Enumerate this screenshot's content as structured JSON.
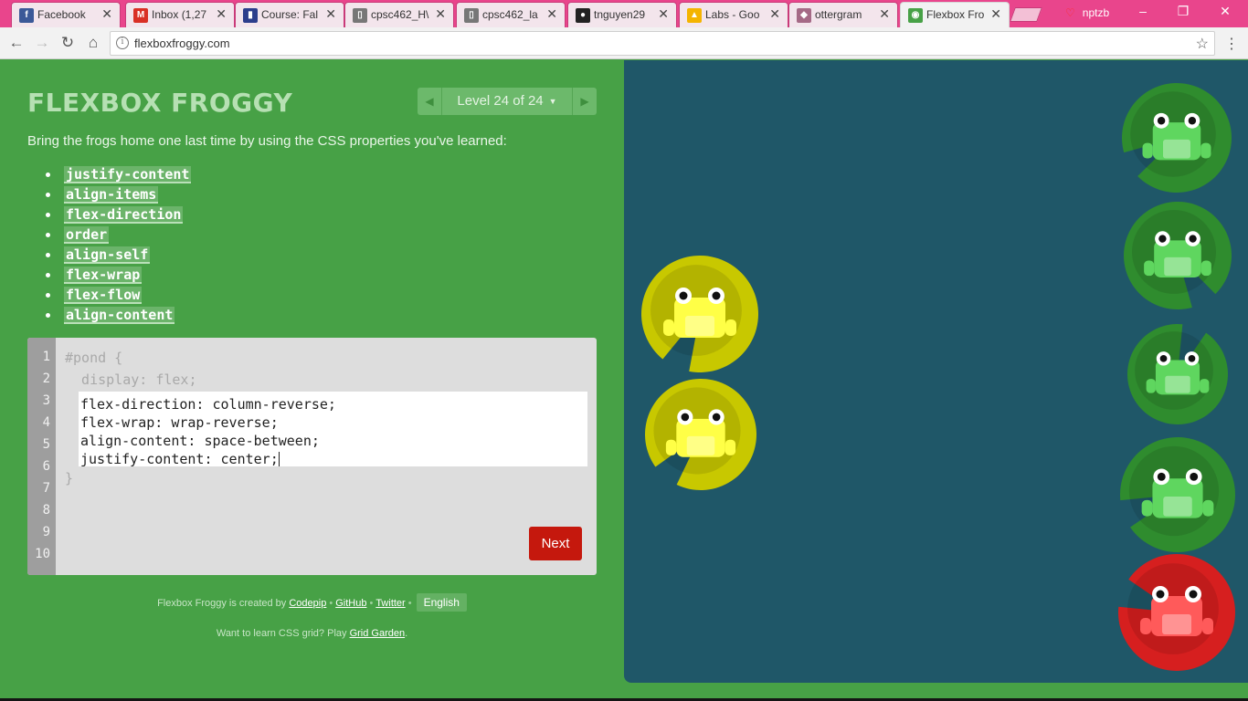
{
  "browser": {
    "tabs": [
      {
        "title": "Facebook",
        "icon": "facebook-icon",
        "color": "#3b5998",
        "glyph": "f"
      },
      {
        "title": "Inbox (1,27",
        "icon": "gmail-icon",
        "color": "#d93025",
        "glyph": "M"
      },
      {
        "title": "Course: Fal",
        "icon": "moodle-icon",
        "color": "#2c3e8c",
        "glyph": "▮"
      },
      {
        "title": "cpsc462_H\\",
        "icon": "document-icon",
        "color": "#777777",
        "glyph": "▯"
      },
      {
        "title": "cpsc462_la",
        "icon": "document-icon",
        "color": "#777777",
        "glyph": "▯"
      },
      {
        "title": "tnguyen29",
        "icon": "github-icon",
        "color": "#222222",
        "glyph": "●"
      },
      {
        "title": "Labs - Goo",
        "icon": "google-drive-icon",
        "color": "#f4b400",
        "glyph": "▲"
      },
      {
        "title": "ottergram",
        "icon": "ottergram-icon",
        "color": "#a56a86",
        "glyph": "◆"
      },
      {
        "title": "Flexbox Fro",
        "icon": "frog-icon",
        "color": "#47a146",
        "glyph": "◉"
      }
    ],
    "active_tab": 8,
    "profile_name": "nptzb",
    "url": "flexboxfroggy.com"
  },
  "game": {
    "title": "FLEXBOX FROGGY",
    "level_label": "Level 24 of 24",
    "instructions": "Bring the frogs home one last time by using the CSS properties you've learned:",
    "properties": [
      "justify-content",
      "align-items",
      "flex-direction",
      "order",
      "align-self",
      "flex-wrap",
      "flex-flow",
      "align-content"
    ],
    "line_numbers": [
      "1",
      "2",
      "3",
      "4",
      "5",
      "6",
      "7",
      "8",
      "9",
      "10"
    ],
    "code_before": [
      "#pond {",
      "  display: flex;"
    ],
    "answer_lines": [
      "flex-direction: column-reverse;",
      "flex-wrap: wrap-reverse;",
      "align-content: space-between;",
      "justify-content: center;"
    ],
    "code_after": "}",
    "next_label": "Next"
  },
  "footer": {
    "credit_prefix": "Flexbox Froggy is created by",
    "codepip_label": "Codepip",
    "github_label": "GitHub",
    "twitter_label": "Twitter",
    "language_label": "English",
    "grid_prefix": "Want to learn CSS grid? Play",
    "grid_link_label": "Grid Garden",
    "grid_suffix": "."
  },
  "pond": {
    "background": "#1f5768",
    "frogs": [
      {
        "color": "yellow",
        "pad_color": "#c8c800",
        "body_color": "#ffff46"
      },
      {
        "color": "yellow",
        "pad_color": "#c8c800",
        "body_color": "#ffff46"
      },
      {
        "color": "green",
        "pad_color": "#2f8c2e",
        "body_color": "#5fd65f"
      },
      {
        "color": "green",
        "pad_color": "#2f8c2e",
        "body_color": "#5fd65f"
      },
      {
        "color": "green",
        "pad_color": "#2f8c2e",
        "body_color": "#5fd65f"
      },
      {
        "color": "green",
        "pad_color": "#2f8c2e",
        "body_color": "#5fd65f"
      },
      {
        "color": "red",
        "pad_color": "#d61f1f",
        "body_color": "#ff5a5a"
      }
    ]
  }
}
